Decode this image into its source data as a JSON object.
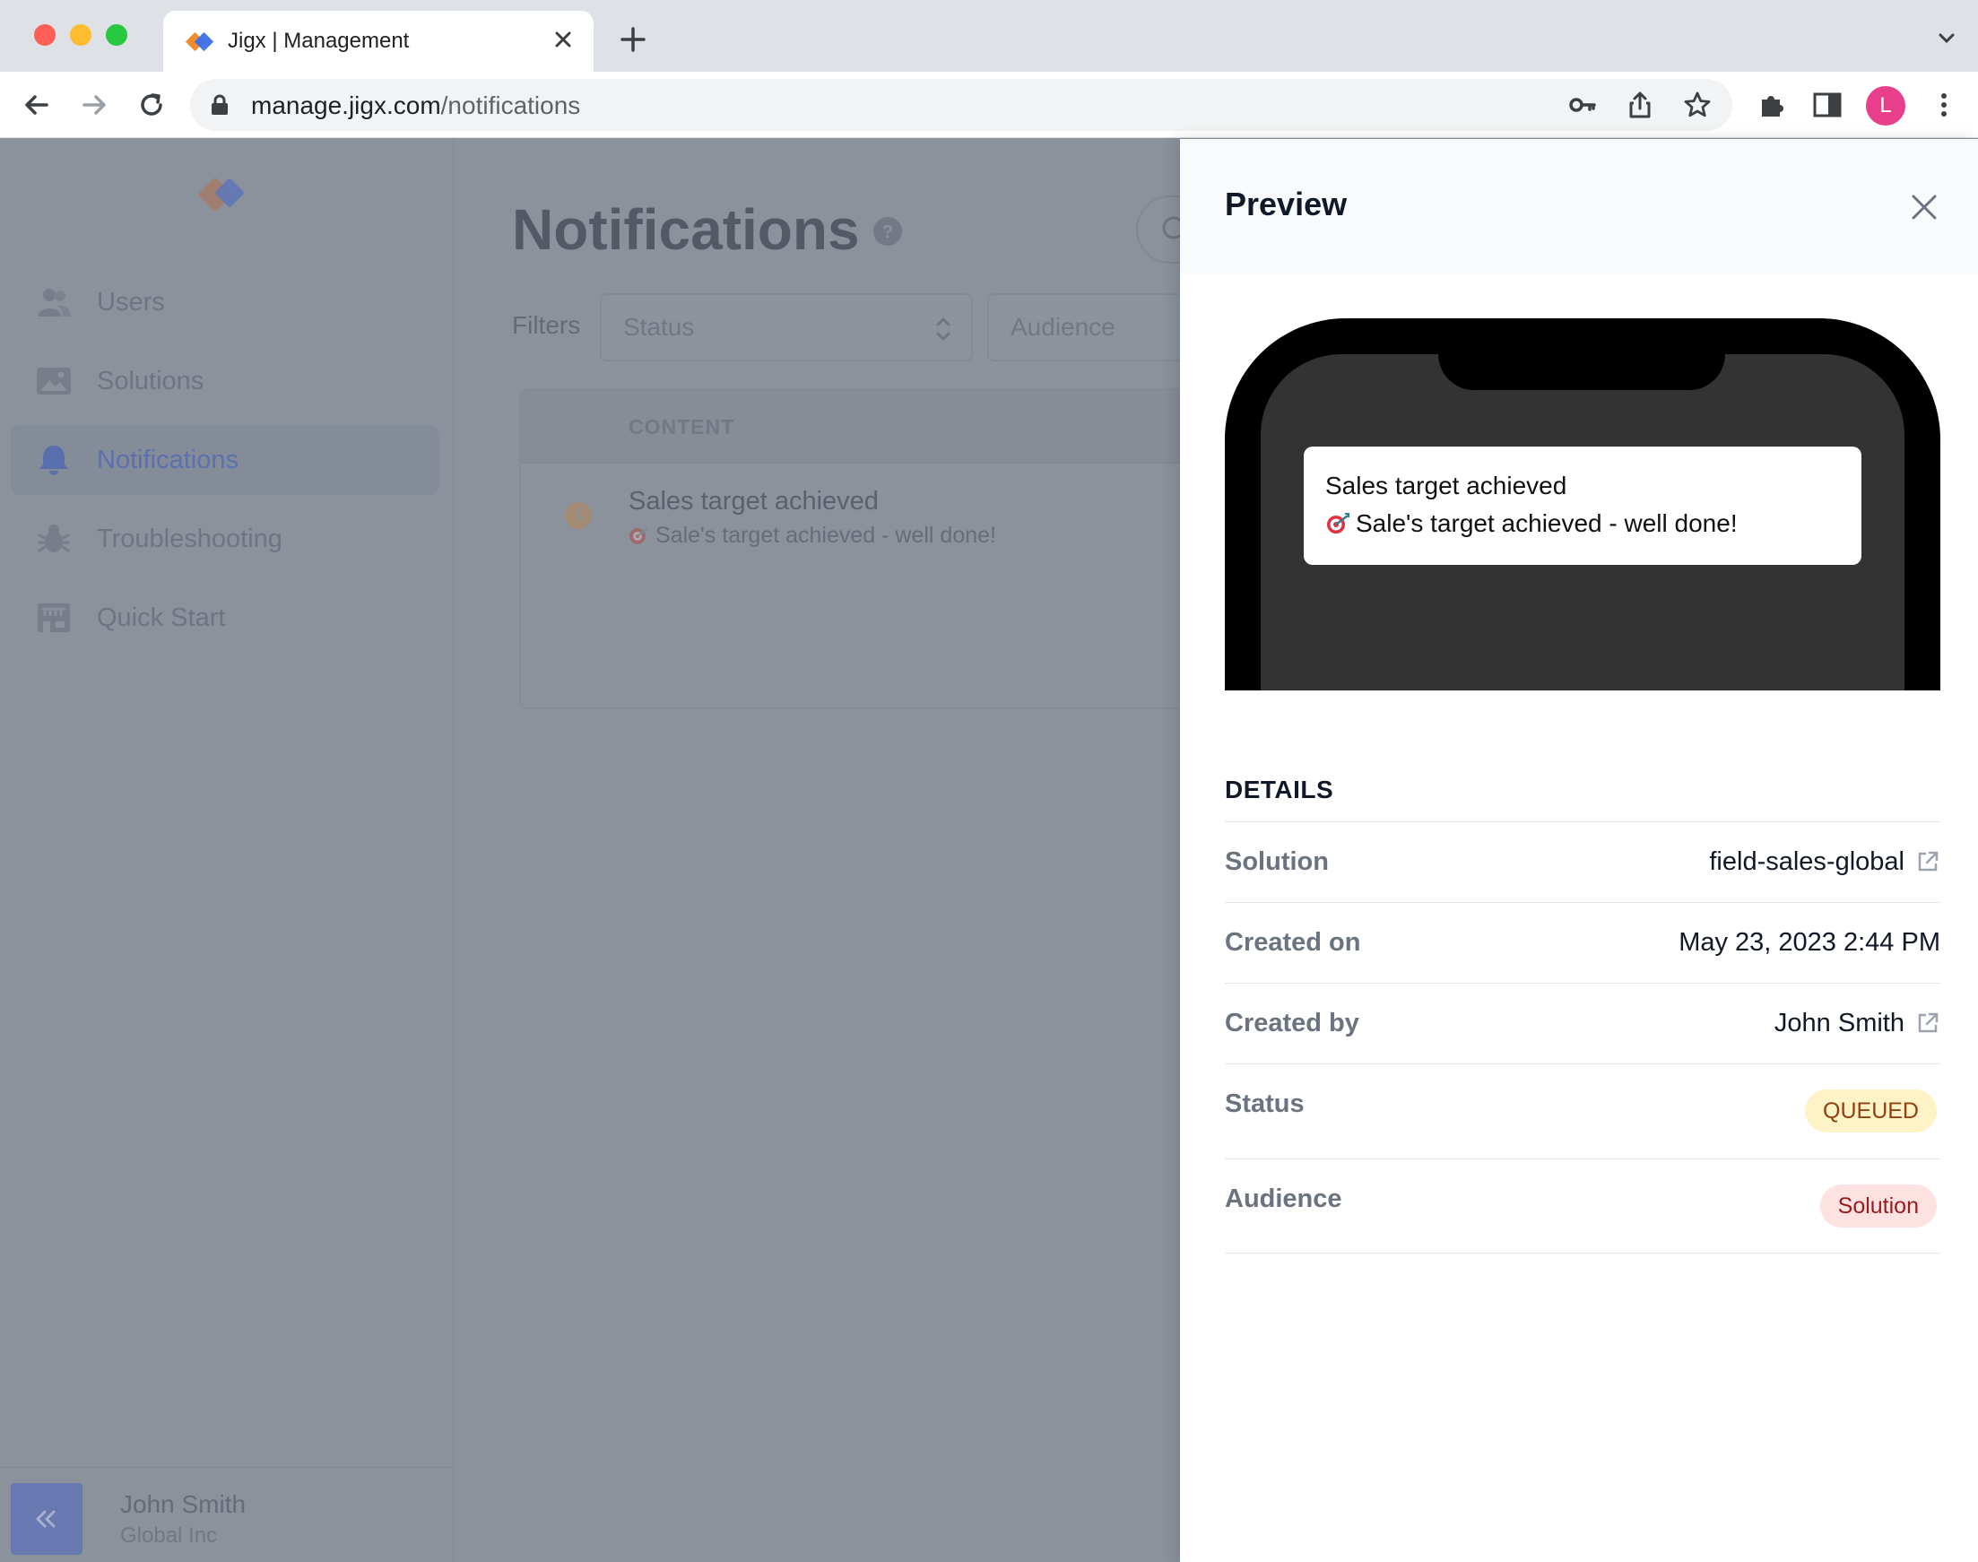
{
  "browser": {
    "tab_title": "Jigx | Management",
    "url_host": "manage.jigx.com",
    "url_path": "/notifications",
    "profile_initial": "L"
  },
  "sidebar": {
    "items": [
      {
        "label": "Users",
        "icon": "users-icon"
      },
      {
        "label": "Solutions",
        "icon": "image-icon"
      },
      {
        "label": "Notifications",
        "icon": "bell-icon",
        "active": true
      },
      {
        "label": "Troubleshooting",
        "icon": "bug-icon"
      },
      {
        "label": "Quick Start",
        "icon": "storefront-icon"
      }
    ],
    "user": {
      "name": "John Smith",
      "org": "Global Inc"
    }
  },
  "main": {
    "title": "Notifications",
    "filters_label": "Filters",
    "filter_status": "Status",
    "filter_audience": "Audience",
    "table": {
      "column_content": "CONTENT",
      "rows": [
        {
          "title": "Sales target achieved",
          "body": "Sale's target achieved - well done!",
          "icon": "clock-icon"
        }
      ]
    }
  },
  "panel": {
    "title": "Preview",
    "notification": {
      "title": "Sales target achieved",
      "body": "Sale's target achieved - well done!",
      "emoji": "direct-hit-emoji"
    },
    "details_heading": "DETAILS",
    "details": {
      "solution_label": "Solution",
      "solution_value": "field-sales-global",
      "created_on_label": "Created on",
      "created_on_value": "May 23, 2023 2:44 PM",
      "created_by_label": "Created by",
      "created_by_value": "John Smith",
      "status_label": "Status",
      "status_value": "QUEUED",
      "audience_label": "Audience",
      "audience_value": "Solution"
    }
  },
  "colors": {
    "accent": "#5c6fae",
    "overlay": "#8c929c",
    "badge_queued_bg": "#fef3c7",
    "badge_solution_bg": "#fee2e2",
    "profile": "#e83e8c"
  }
}
